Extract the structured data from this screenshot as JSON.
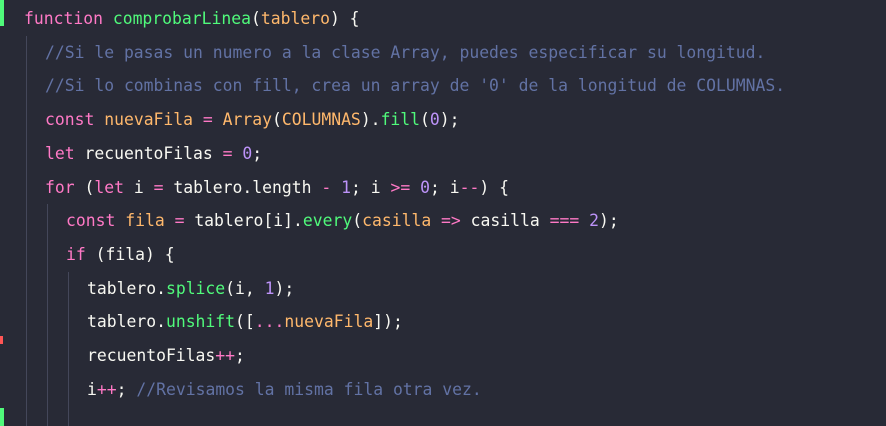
{
  "editor": {
    "language": "javascript",
    "theme_colors": {
      "background": "#282a36",
      "keyword": "#ff79c6",
      "function": "#50fa7b",
      "parameter": "#ffb86c",
      "variable": "#f8f8f2",
      "comment": "#6272a4",
      "number": "#bd93f9",
      "string": "#f1fa8c",
      "cyan": "#8be9fd",
      "indent_guide": "#44475a",
      "gutter_modified": "#50fa7b",
      "gutter_deleted": "#ff5555"
    },
    "lines": [
      {
        "indent": 0,
        "tokens": [
          {
            "t": "function",
            "c": "keyword"
          },
          {
            "t": " ",
            "c": "plain"
          },
          {
            "t": "comprobarLinea",
            "c": "function"
          },
          {
            "t": "(",
            "c": "plain"
          },
          {
            "t": "tablero",
            "c": "parameter"
          },
          {
            "t": ") {",
            "c": "plain"
          }
        ]
      },
      {
        "indent": 1,
        "tokens": [
          {
            "t": "//Si le pasas un numero a la clase Array, puedes especificar su longitud.",
            "c": "comment"
          }
        ]
      },
      {
        "indent": 1,
        "tokens": [
          {
            "t": "//Si lo combinas con fill, crea un array de '0' de la longitud de COLUMNAS.",
            "c": "comment"
          }
        ]
      },
      {
        "indent": 1,
        "tokens": [
          {
            "t": "const",
            "c": "keyword"
          },
          {
            "t": " ",
            "c": "plain"
          },
          {
            "t": "nuevaFila",
            "c": "parameter"
          },
          {
            "t": " = ",
            "c": "keyword"
          },
          {
            "t": "Array",
            "c": "parameter"
          },
          {
            "t": "(",
            "c": "plain"
          },
          {
            "t": "COLUMNAS",
            "c": "parameter"
          },
          {
            "t": ").",
            "c": "plain"
          },
          {
            "t": "fill",
            "c": "function"
          },
          {
            "t": "(",
            "c": "plain"
          },
          {
            "t": "0",
            "c": "number"
          },
          {
            "t": ");",
            "c": "plain"
          }
        ]
      },
      {
        "indent": 1,
        "tokens": [
          {
            "t": "let",
            "c": "keyword"
          },
          {
            "t": " ",
            "c": "plain"
          },
          {
            "t": "recuentoFilas",
            "c": "variable"
          },
          {
            "t": " = ",
            "c": "keyword"
          },
          {
            "t": "0",
            "c": "number"
          },
          {
            "t": ";",
            "c": "plain"
          }
        ]
      },
      {
        "indent": 1,
        "tokens": [
          {
            "t": "for",
            "c": "keyword"
          },
          {
            "t": " (",
            "c": "plain"
          },
          {
            "t": "let",
            "c": "keyword"
          },
          {
            "t": " ",
            "c": "plain"
          },
          {
            "t": "i",
            "c": "variable"
          },
          {
            "t": " = ",
            "c": "keyword"
          },
          {
            "t": "tablero",
            "c": "variable"
          },
          {
            "t": ".",
            "c": "plain"
          },
          {
            "t": "length",
            "c": "variable"
          },
          {
            "t": " - ",
            "c": "keyword"
          },
          {
            "t": "1",
            "c": "number"
          },
          {
            "t": "; ",
            "c": "plain"
          },
          {
            "t": "i",
            "c": "variable"
          },
          {
            "t": " >= ",
            "c": "keyword"
          },
          {
            "t": "0",
            "c": "number"
          },
          {
            "t": "; ",
            "c": "plain"
          },
          {
            "t": "i",
            "c": "variable"
          },
          {
            "t": "--",
            "c": "keyword"
          },
          {
            "t": ") {",
            "c": "plain"
          }
        ]
      },
      {
        "indent": 2,
        "tokens": [
          {
            "t": "const",
            "c": "keyword"
          },
          {
            "t": " ",
            "c": "plain"
          },
          {
            "t": "fila",
            "c": "parameter"
          },
          {
            "t": " = ",
            "c": "keyword"
          },
          {
            "t": "tablero",
            "c": "variable"
          },
          {
            "t": "[",
            "c": "plain"
          },
          {
            "t": "i",
            "c": "variable"
          },
          {
            "t": "].",
            "c": "plain"
          },
          {
            "t": "every",
            "c": "function"
          },
          {
            "t": "(",
            "c": "plain"
          },
          {
            "t": "casilla",
            "c": "parameter"
          },
          {
            "t": " => ",
            "c": "keyword"
          },
          {
            "t": "casilla",
            "c": "variable"
          },
          {
            "t": " === ",
            "c": "keyword"
          },
          {
            "t": "2",
            "c": "number"
          },
          {
            "t": ");",
            "c": "plain"
          }
        ]
      },
      {
        "indent": 2,
        "tokens": [
          {
            "t": "if",
            "c": "keyword"
          },
          {
            "t": " (",
            "c": "plain"
          },
          {
            "t": "fila",
            "c": "variable"
          },
          {
            "t": ") {",
            "c": "plain"
          }
        ]
      },
      {
        "indent": 3,
        "tokens": [
          {
            "t": "tablero",
            "c": "variable"
          },
          {
            "t": ".",
            "c": "plain"
          },
          {
            "t": "splice",
            "c": "function"
          },
          {
            "t": "(",
            "c": "plain"
          },
          {
            "t": "i",
            "c": "variable"
          },
          {
            "t": ", ",
            "c": "plain"
          },
          {
            "t": "1",
            "c": "number"
          },
          {
            "t": ");",
            "c": "plain"
          }
        ]
      },
      {
        "indent": 3,
        "tokens": [
          {
            "t": "tablero",
            "c": "variable"
          },
          {
            "t": ".",
            "c": "plain"
          },
          {
            "t": "unshift",
            "c": "function"
          },
          {
            "t": "([",
            "c": "plain"
          },
          {
            "t": "...",
            "c": "keyword"
          },
          {
            "t": "nuevaFila",
            "c": "parameter"
          },
          {
            "t": "]);",
            "c": "plain"
          }
        ]
      },
      {
        "indent": 3,
        "tokens": [
          {
            "t": "recuentoFilas",
            "c": "variable"
          },
          {
            "t": "++",
            "c": "keyword"
          },
          {
            "t": ";",
            "c": "plain"
          }
        ]
      },
      {
        "indent": 3,
        "tokens": [
          {
            "t": "i",
            "c": "variable"
          },
          {
            "t": "++",
            "c": "keyword"
          },
          {
            "t": "; ",
            "c": "plain"
          },
          {
            "t": "//Revisamos la misma fila otra vez.",
            "c": "comment"
          }
        ]
      },
      {
        "indent": 3,
        "tokens": []
      }
    ]
  }
}
